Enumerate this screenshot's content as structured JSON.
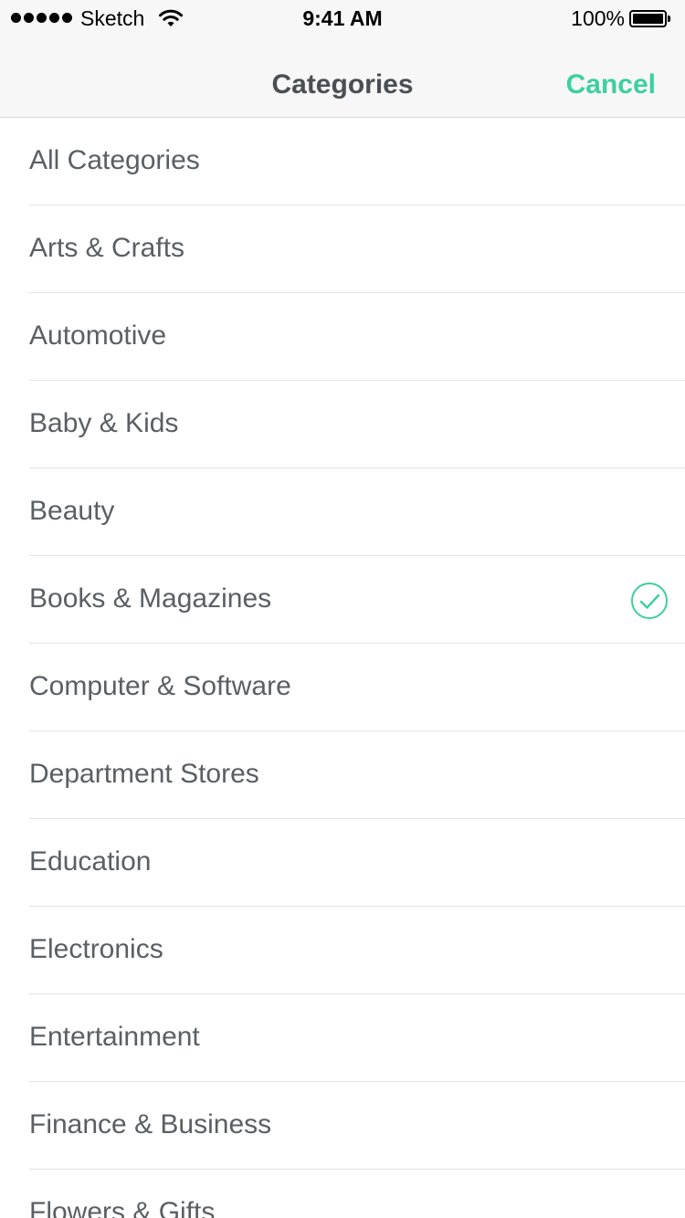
{
  "status_bar": {
    "carrier": "Sketch",
    "time": "9:41 AM",
    "battery": "100%",
    "battery_level": 1.0,
    "signal_bars": 5
  },
  "nav": {
    "title": "Categories",
    "cancel_label": "Cancel"
  },
  "colors": {
    "accent": "#3dcfa2",
    "text": "#5a5f64",
    "title": "#4a4f54"
  },
  "categories": [
    {
      "label": "All Categories",
      "selected": false
    },
    {
      "label": "Arts & Crafts",
      "selected": false
    },
    {
      "label": "Automotive",
      "selected": false
    },
    {
      "label": "Baby & Kids",
      "selected": false
    },
    {
      "label": "Beauty",
      "selected": false
    },
    {
      "label": "Books & Magazines",
      "selected": true,
      "icon": "checkmark-circle-icon"
    },
    {
      "label": "Computer & Software",
      "selected": false
    },
    {
      "label": "Department Stores",
      "selected": false
    },
    {
      "label": "Education",
      "selected": false
    },
    {
      "label": "Electronics",
      "selected": false
    },
    {
      "label": "Entertainment",
      "selected": false
    },
    {
      "label": "Finance & Business",
      "selected": false
    },
    {
      "label": "Flowers & Gifts",
      "selected": false
    }
  ]
}
